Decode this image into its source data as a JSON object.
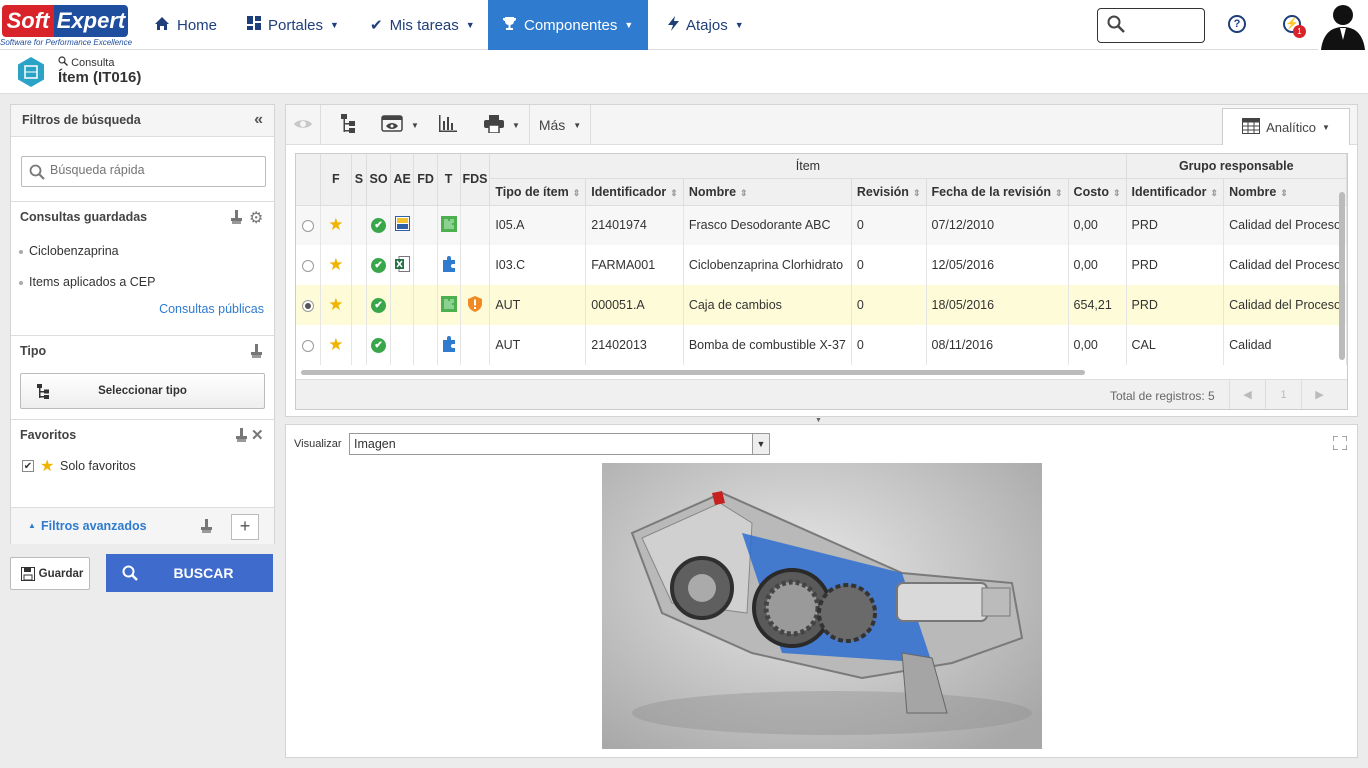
{
  "logo": {
    "left": "Soft",
    "right": "Expert",
    "tagline": "Software for Performance Excellence"
  },
  "nav": {
    "home": "Home",
    "portals": "Portales",
    "tasks": "Mis tareas",
    "components": "Componentes",
    "shortcuts": "Atajos"
  },
  "header": {
    "help": "?",
    "notifications_count": "1"
  },
  "page": {
    "small": "Consulta",
    "title": "Ítem (IT016)"
  },
  "left": {
    "title": "Filtros de búsqueda",
    "quick_search_placeholder": "Búsqueda rápida",
    "saved": {
      "title": "Consultas guardadas",
      "items": [
        "Ciclobenzaprina",
        "Items aplicados a CEP"
      ],
      "public_link": "Consultas públicas"
    },
    "type": {
      "title": "Tipo",
      "button": "Seleccionar tipo"
    },
    "favorites": {
      "title": "Favoritos",
      "only_label": "Solo favoritos",
      "checked": true
    },
    "advanced": "Filtros avanzados",
    "save_button": "Guardar",
    "search_button": "BUSCAR"
  },
  "toolbar": {
    "more": "Más",
    "view": "Analítico"
  },
  "grid": {
    "group_item": "Ítem",
    "group_resp": "Grupo responsable",
    "icon_columns": [
      "F",
      "S",
      "SO",
      "AE",
      "FD",
      "T",
      "FDS"
    ],
    "columns": [
      "Tipo de ítem",
      "Identificador",
      "Nombre",
      "Revisión",
      "Fecha de la revisión",
      "Costo",
      "Identificador",
      "Nombre"
    ],
    "rows": [
      {
        "type": "I05.A",
        "id": "21401974",
        "name": "Frasco Desodorante ABC",
        "rev": "0",
        "date": "07/12/2010",
        "cost": "0,00",
        "group_id": "PRD",
        "group_name": "Calidad del Proceso",
        "ae": "ae-image-icon",
        "t": "green-puzzle-icon",
        "fds": ""
      },
      {
        "type": "I03.C",
        "id": "FARMA001",
        "name": "Ciclobenzaprina Clorhidrato",
        "rev": "0",
        "date": "12/05/2016",
        "cost": "0,00",
        "group_id": "PRD",
        "group_name": "Calidad del Proceso",
        "ae": "excel-icon",
        "t": "blue-puzzle-icon",
        "fds": ""
      },
      {
        "type": "AUT",
        "id": "000051.A",
        "name": "Caja de cambios",
        "rev": "0",
        "date": "18/05/2016",
        "cost": "654,21",
        "group_id": "PRD",
        "group_name": "Calidad del Proceso",
        "ae": "",
        "t": "green-puzzle-icon",
        "fds": "warning-shield-icon"
      },
      {
        "type": "AUT",
        "id": "21402013",
        "name": "Bomba de combustible X-37",
        "rev": "0",
        "date": "08/11/2016",
        "cost": "0,00",
        "group_id": "CAL",
        "group_name": "Calidad",
        "ae": "",
        "t": "blue-puzzle-icon",
        "fds": ""
      }
    ],
    "selected_row": 2,
    "total": "Total de registros: 5",
    "page": "1"
  },
  "preview": {
    "label": "Visualizar",
    "select_value": "Imagen",
    "image": "transmission-gearbox-image"
  },
  "colors": {
    "accent": "#2e7bcf",
    "nav_text": "#1f3f7a",
    "search_button": "#3f6bcc",
    "selected_row": "#fefcd8",
    "brand_red": "#d8232a",
    "brand_blue": "#1f4e9e"
  }
}
